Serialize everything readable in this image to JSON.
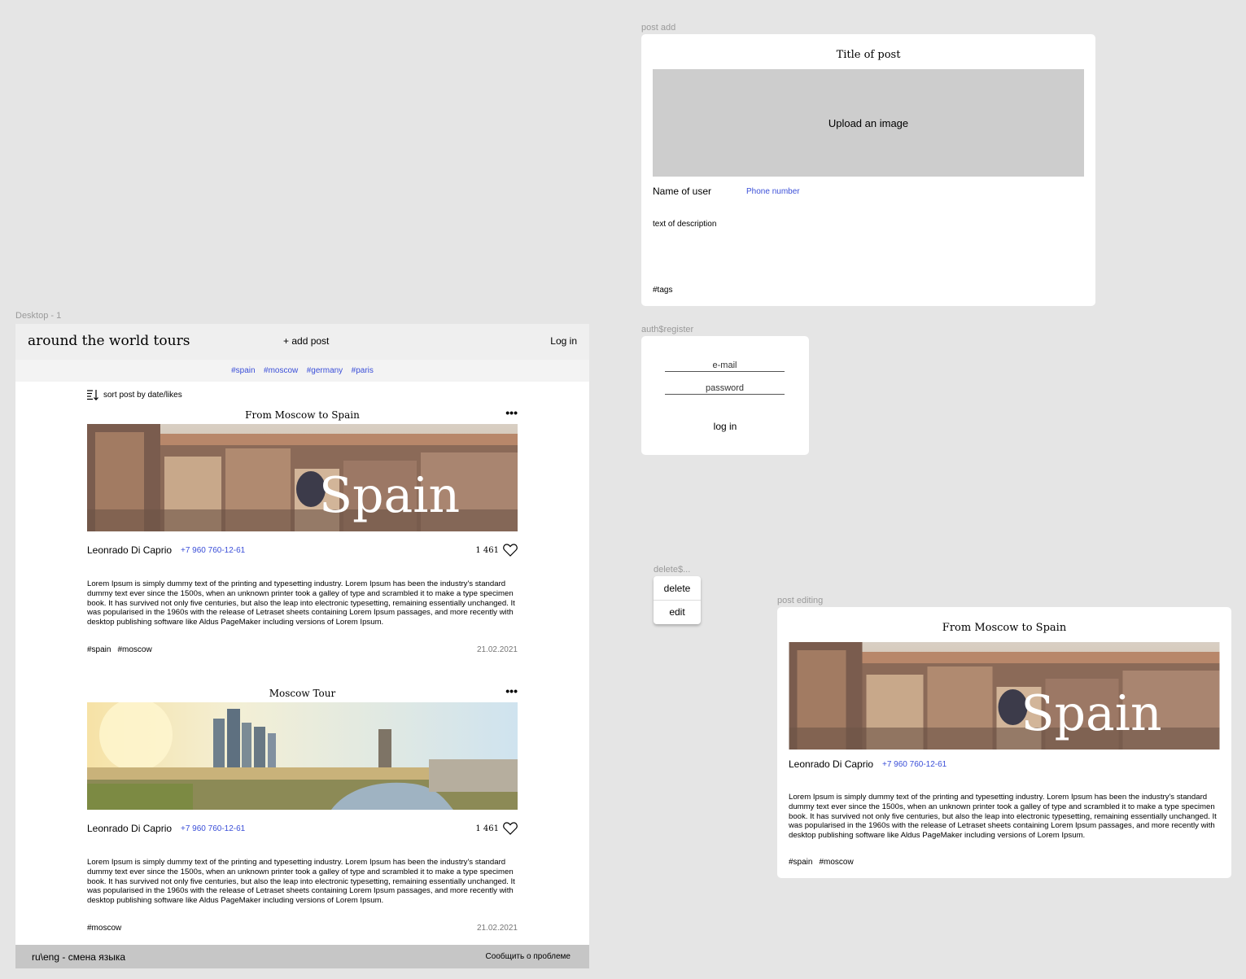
{
  "frames": {
    "post_add": "post add",
    "desktop": "Desktop - 1",
    "auth": "auth$register",
    "delete": "delete$...",
    "post_editing": "post editing"
  },
  "header": {
    "brand": "around the world tours",
    "add_post": "+ add post",
    "login": "Log in"
  },
  "tag_filters": [
    "#spain",
    "#moscow",
    "#germany",
    "#paris"
  ],
  "sort_label": "sort post by date/likes",
  "posts": [
    {
      "title": "From Moscow to Spain",
      "image_text": "Spain",
      "author": "Leonrado Di Caprio",
      "phone": "+7 960 760-12-61",
      "likes": "1 461",
      "description": "Lorem Ipsum is simply dummy text of the printing and typesetting industry. Lorem Ipsum has been the industry's standard dummy text ever since the 1500s, when an unknown printer took a galley of type and scrambled it to make a type specimen book. It has survived not only five centuries, but also the leap into electronic typesetting, remaining essentially unchanged. It was popularised in the 1960s with the release of Letraset sheets containing Lorem Ipsum passages, and more recently with desktop publishing software like Aldus PageMaker including versions of Lorem Ipsum.",
      "tags": [
        "#spain",
        "#moscow"
      ],
      "date": "21.02.2021"
    },
    {
      "title": "Moscow Tour",
      "author": "Leonrado Di Caprio",
      "phone": "+7 960 760-12-61",
      "likes": "1 461",
      "description": "Lorem Ipsum is simply dummy text of the printing and typesetting industry. Lorem Ipsum has been the industry's standard dummy text ever since the 1500s, when an unknown printer took a galley of type and scrambled it to make a type specimen book. It has survived not only five centuries, but also the leap into electronic typesetting, remaining essentially unchanged. It was popularised in the 1960s with the release of Letraset sheets containing Lorem Ipsum passages, and more recently with desktop publishing software like Aldus PageMaker including versions of Lorem Ipsum.",
      "tags": [
        "#moscow"
      ],
      "date": "21.02.2021"
    }
  ],
  "footer": {
    "language": "ru\\eng - смена языка",
    "report": "Сообщить о проблеме"
  },
  "post_add": {
    "title": "Title of post",
    "upload": "Upload an image",
    "user": "Name of user",
    "phone": "Phone number",
    "description": "text of description",
    "tags": "#tags"
  },
  "auth": {
    "email": "e-mail",
    "password": "password",
    "button": "log in"
  },
  "menu": {
    "delete": "delete",
    "edit": "edit"
  },
  "post_edit": {
    "title": "From Moscow to Spain",
    "image_text": "Spain",
    "author": "Leonrado Di Caprio",
    "phone": "+7 960 760-12-61",
    "description": "Lorem Ipsum is simply dummy text of the printing and typesetting industry. Lorem Ipsum has been the industry's standard dummy text ever since the 1500s, when an unknown printer took a galley of type and scrambled it to make a type specimen book. It has survived not only five centuries, but also the leap into electronic typesetting, remaining essentially unchanged. It was popularised in the 1960s with the release of Letraset sheets containing Lorem Ipsum passages, and more recently with desktop publishing software like Aldus PageMaker including versions of Lorem Ipsum.",
    "tags": [
      "#spain",
      "#moscow"
    ]
  },
  "colors": {
    "canvas": "#e5e5e5",
    "link": "#3b4fd8",
    "header": "#efefef",
    "footer": "#c6c6c6",
    "upload": "#cdcdcd"
  },
  "icons": [
    "sort-icon",
    "more-icon",
    "heart-icon"
  ]
}
